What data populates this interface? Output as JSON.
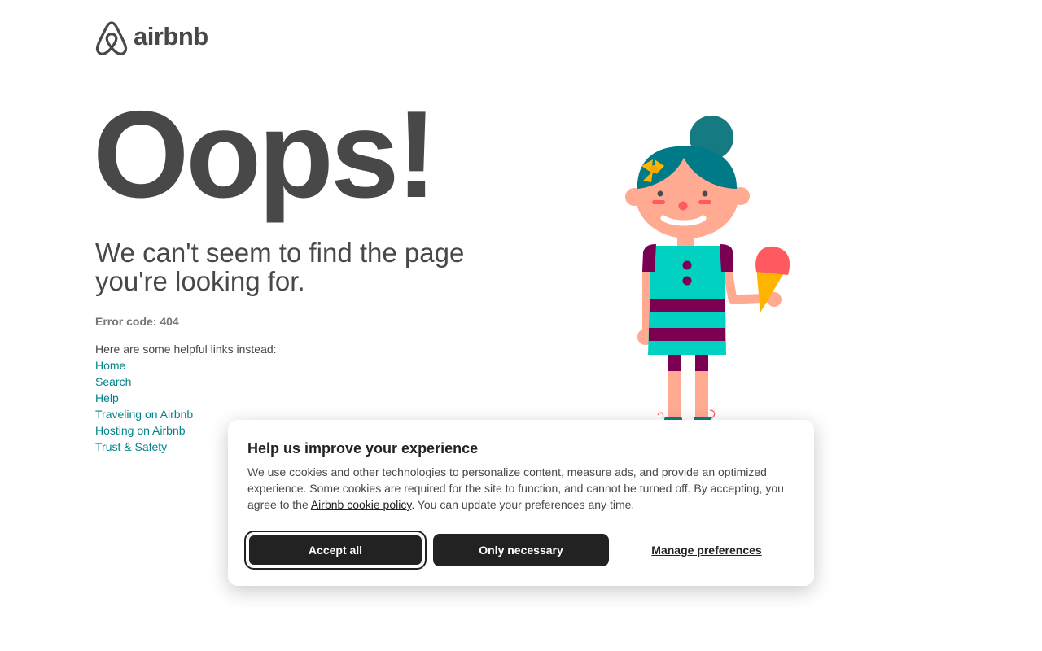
{
  "brand": {
    "name": "airbnb",
    "logo_icon": "airbnb-belo-icon",
    "color": "#484848"
  },
  "main": {
    "headline": "Oops!",
    "subhead": "We can't seem to find the page you're looking for.",
    "error_code": "Error code: 404",
    "links_intro": "Here are some helpful links instead:",
    "links": [
      {
        "label": "Home"
      },
      {
        "label": "Search"
      },
      {
        "label": "Help"
      },
      {
        "label": "Traveling on Airbnb"
      },
      {
        "label": "Hosting on Airbnb"
      },
      {
        "label": "Trust & Safety"
      }
    ],
    "link_color": "#008489",
    "illustration": "girl-with-ice-cream-illustration"
  },
  "cookie_banner": {
    "title": "Help us improve your experience",
    "text_before_link": "We use cookies and other technologies to personalize content, measure ads, and provide an optimized experience. Some cookies are required for the site to function, and cannot be turned off. By accepting, you agree to the ",
    "policy_link": "Airbnb cookie policy",
    "text_after_link": ". You can update your preferences any time.",
    "accept_label": "Accept all",
    "necessary_label": "Only necessary",
    "manage_label": "Manage preferences",
    "button_color": "#222222"
  }
}
